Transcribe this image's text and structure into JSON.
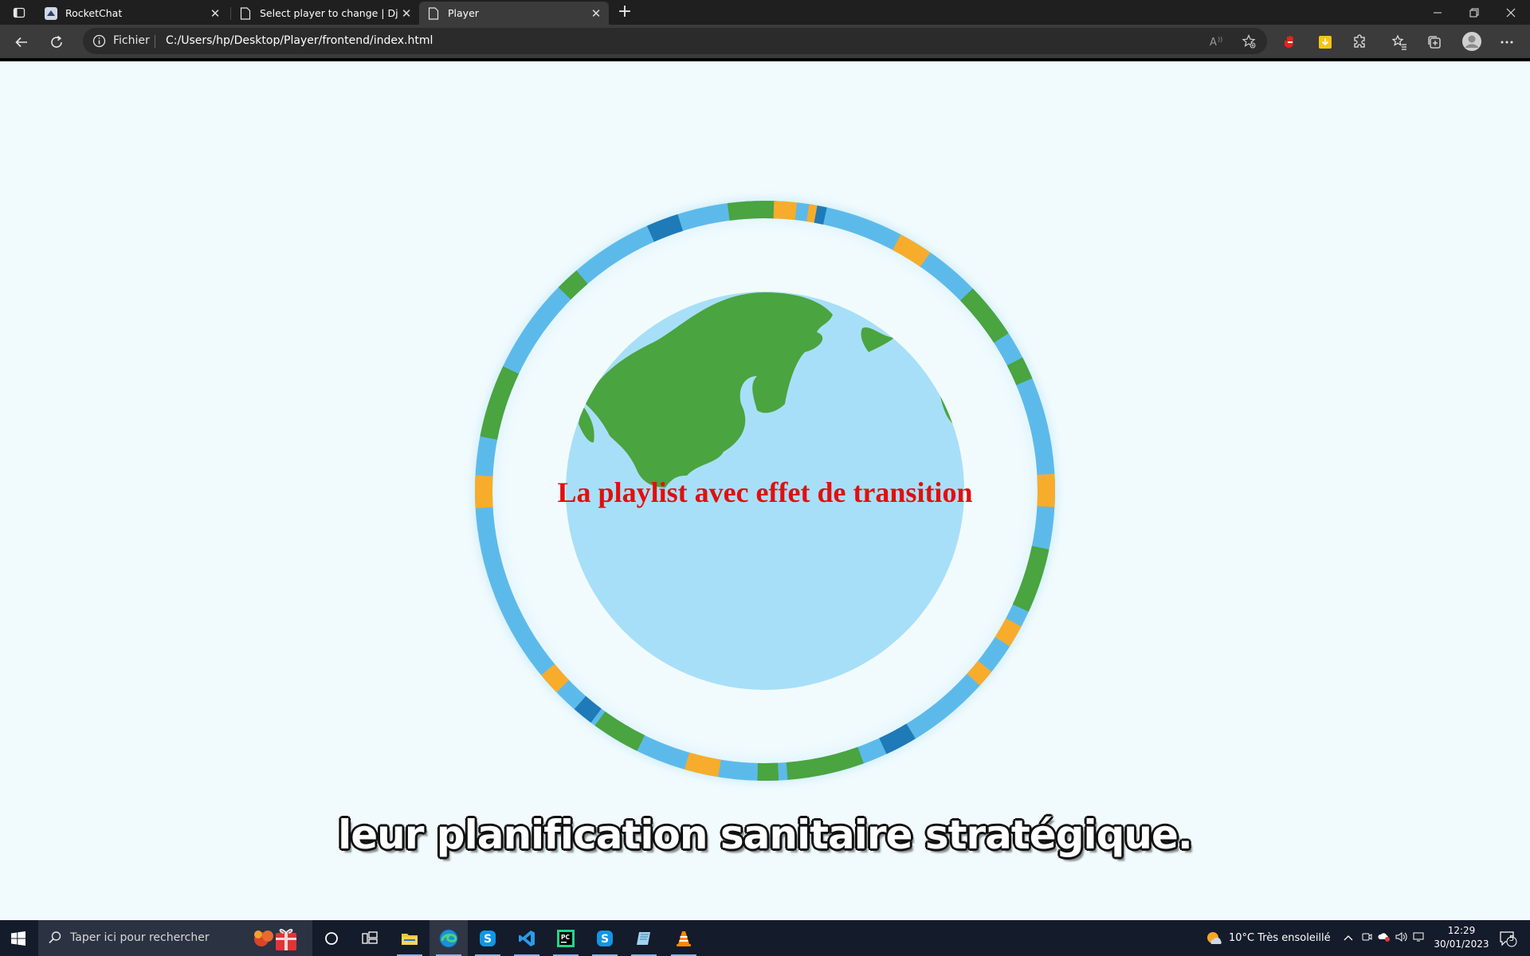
{
  "browser": {
    "tabs": [
      {
        "title": "RocketChat",
        "icon": "rocketchat-icon",
        "active": false
      },
      {
        "title": "Select player to change | Django",
        "icon": "page-icon",
        "active": false
      },
      {
        "title": "Player",
        "icon": "page-icon",
        "active": true
      }
    ],
    "address": {
      "scheme_label": "Fichier",
      "url": "C:/Users/hp/Desktop/Player/frontend/index.html"
    },
    "colors": {
      "titlebar": "#1f1f1f",
      "toolbar": "#3b3b3b",
      "omnibox": "#2b2b2b"
    }
  },
  "page": {
    "headline": "La playlist avec effet de transition",
    "subtitle": "leur planification sanitaire stratégique.",
    "colors": {
      "background": "#f1fbfe",
      "headline": "#e10f0f",
      "globe_ocean": "#a8dff8",
      "globe_land": "#4aa43f",
      "ring_light_blue": "#5cbaeb",
      "ring_green": "#4aa43f",
      "ring_orange": "#f8ac2b",
      "ring_dark_blue": "#1f7ab8"
    }
  },
  "taskbar": {
    "search_placeholder": "Taper ici pour rechercher",
    "apps": [
      "cortana-icon",
      "task-view-icon",
      "file-explorer-icon",
      "edge-icon",
      "skype-icon",
      "vscode-icon",
      "pycharm-icon",
      "skype-icon",
      "notepad-icon",
      "vlc-icon"
    ],
    "weather": "10°C  Très ensoleillé",
    "time": "12:29",
    "date": "30/01/2023",
    "notifications": "5"
  }
}
